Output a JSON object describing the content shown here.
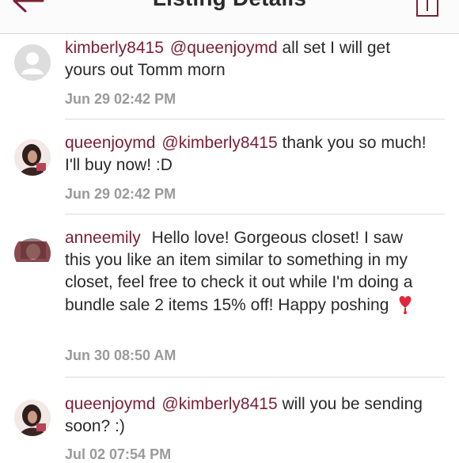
{
  "header": {
    "title": "Listing Details"
  },
  "comments": [
    {
      "user": "kimberly8415",
      "mention": "@queenjoymd",
      "text": "all set I will get yours out Tomm morn",
      "time": "Jun 29 02:42 PM"
    },
    {
      "user": "queenjoymd",
      "mention": "@kimberly8415",
      "text": "thank you so much! I'll buy now! :D",
      "time": "Jun 29 02:42 PM"
    },
    {
      "user": "anneemily",
      "text": "Hello love! Gorgeous closet! I saw this you like an item similar to something in my closet, feel free to check it out while I'm doing a bundle sale 2 items 15% off! Happy poshing",
      "time": "Jun 30 08:50 AM"
    },
    {
      "user": "queenjoymd",
      "mention": "@kimberly8415",
      "text": "will you be sending soon? :)",
      "time": "Jul 02 07:54 PM"
    }
  ],
  "colors": {
    "username": "#7a2236",
    "timestamp": "#9a9a9a"
  },
  "icons": {
    "back": "back-arrow-icon",
    "share": "share-icon",
    "heart": "heart-emoji-icon"
  }
}
